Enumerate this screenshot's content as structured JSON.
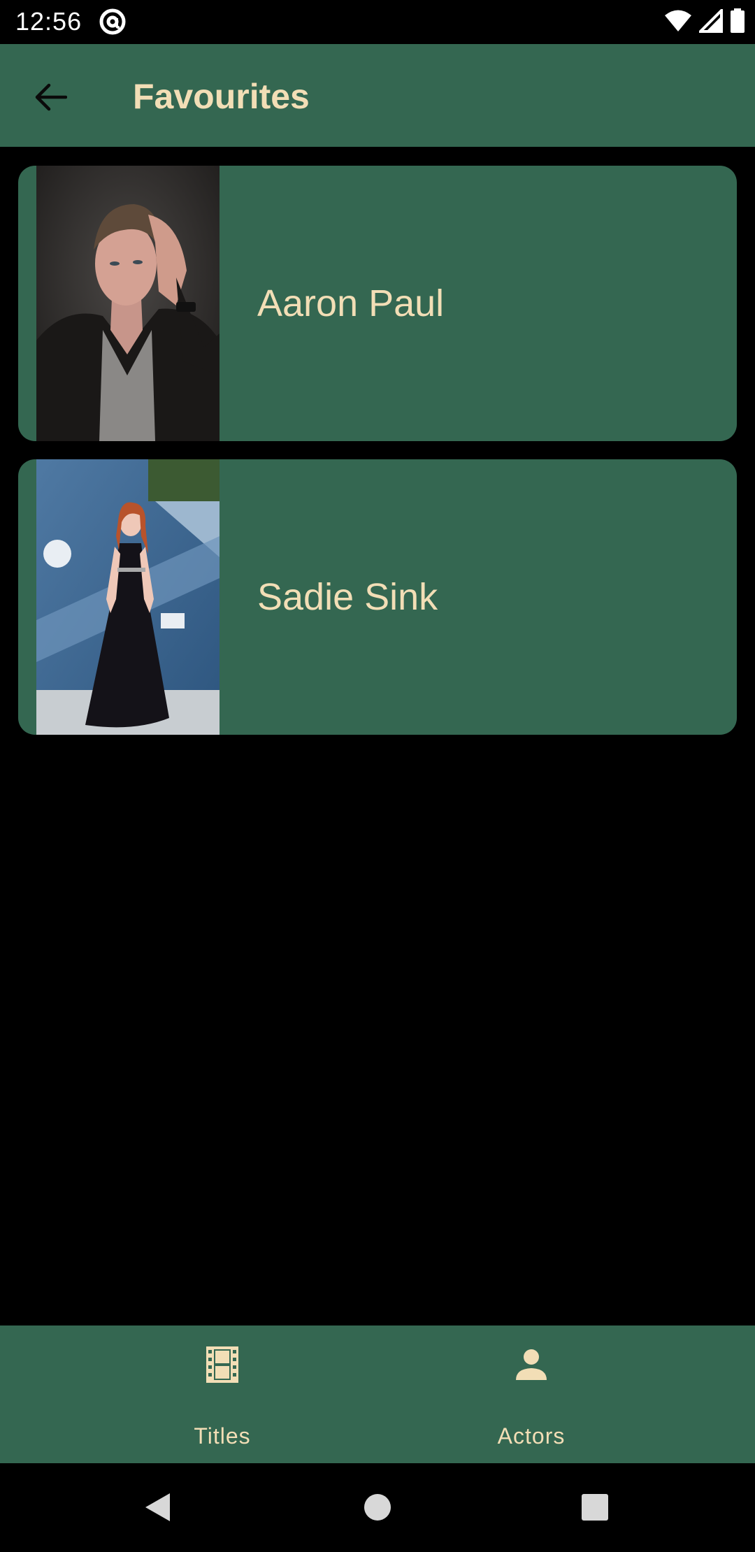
{
  "status": {
    "time": "12:56",
    "at_icon": "at-sign-icon",
    "icons": [
      "wifi-icon",
      "signal-icon",
      "battery-icon"
    ]
  },
  "appbar": {
    "title": "Favourites",
    "back_icon": "arrow-back-icon"
  },
  "favourites": [
    {
      "name": "Aaron Paul",
      "photo": "actor-photo-aaron-paul"
    },
    {
      "name": "Sadie Sink",
      "photo": "actor-photo-sadie-sink"
    }
  ],
  "bottom_nav": {
    "items": [
      {
        "label": "Titles",
        "icon": "film-icon"
      },
      {
        "label": "Actors",
        "icon": "person-icon"
      }
    ]
  },
  "colors": {
    "primary": "#346751",
    "text_accent": "#f2deb6",
    "background": "#000000"
  }
}
